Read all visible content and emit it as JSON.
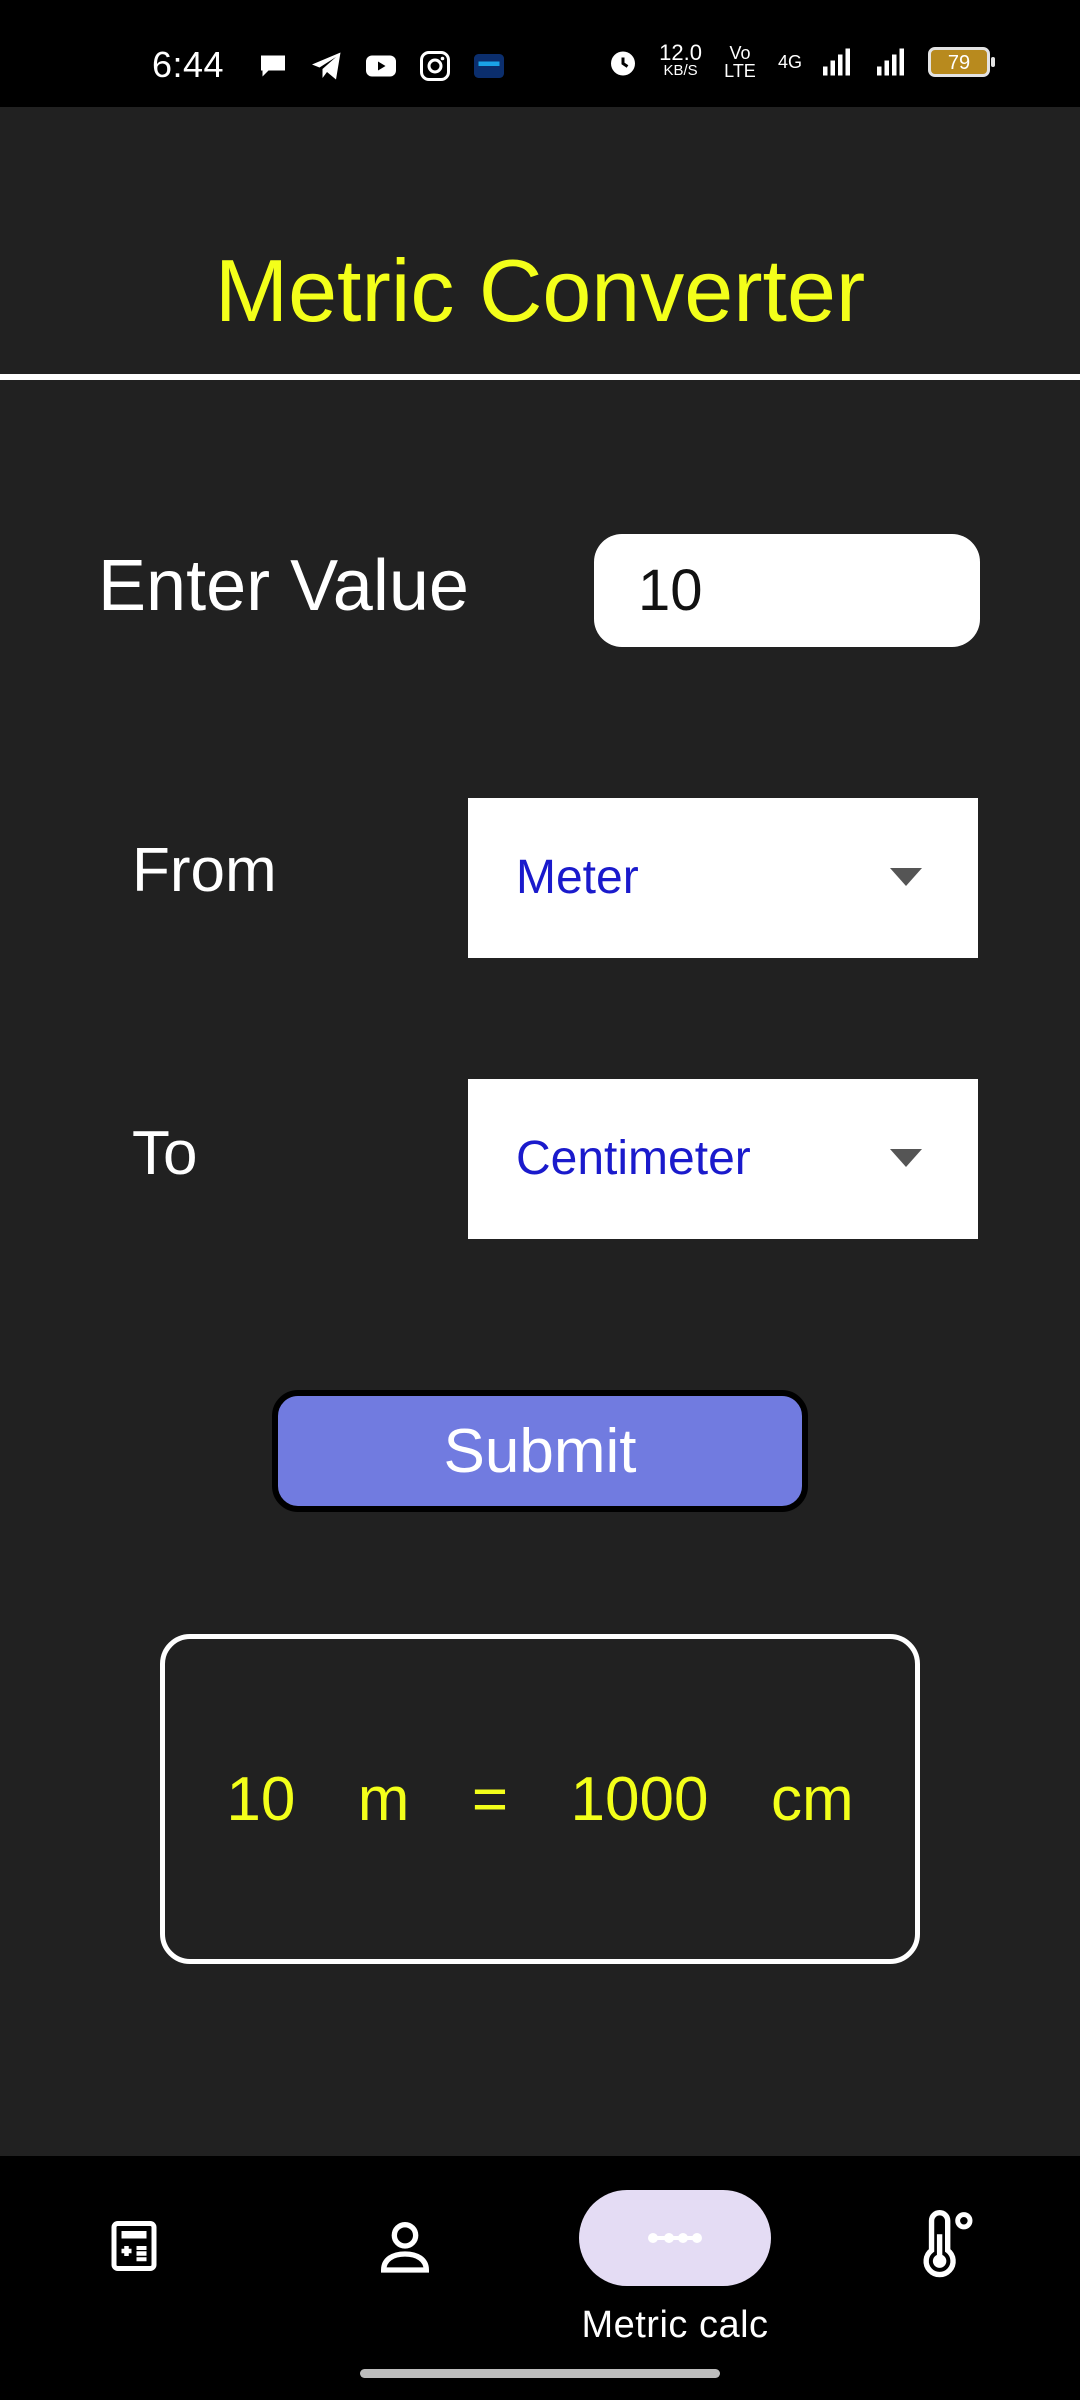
{
  "status_bar": {
    "time": "6:44",
    "net_speed": "12.0",
    "net_unit": "KB/S",
    "volte": "Vo LTE",
    "network": "4G",
    "battery": "79"
  },
  "app": {
    "title": "Metric Converter"
  },
  "form": {
    "value_label": "Enter Value",
    "value": "10",
    "from_label": "From",
    "from_selected": "Meter",
    "to_label": "To",
    "to_selected": "Centimeter",
    "submit_label": "Submit"
  },
  "result": {
    "text": "10  m  =  1000  cm"
  },
  "bottom_nav": {
    "items": [
      {
        "icon": "calculator-icon"
      },
      {
        "icon": "person-icon"
      },
      {
        "icon": "dots-icon",
        "label": "Metric calc",
        "active": true
      },
      {
        "icon": "thermometer-icon"
      }
    ]
  },
  "colors": {
    "background": "#212121",
    "title": "#f3ff1a",
    "submit": "#717be0",
    "select_text": "#1a1acc"
  }
}
